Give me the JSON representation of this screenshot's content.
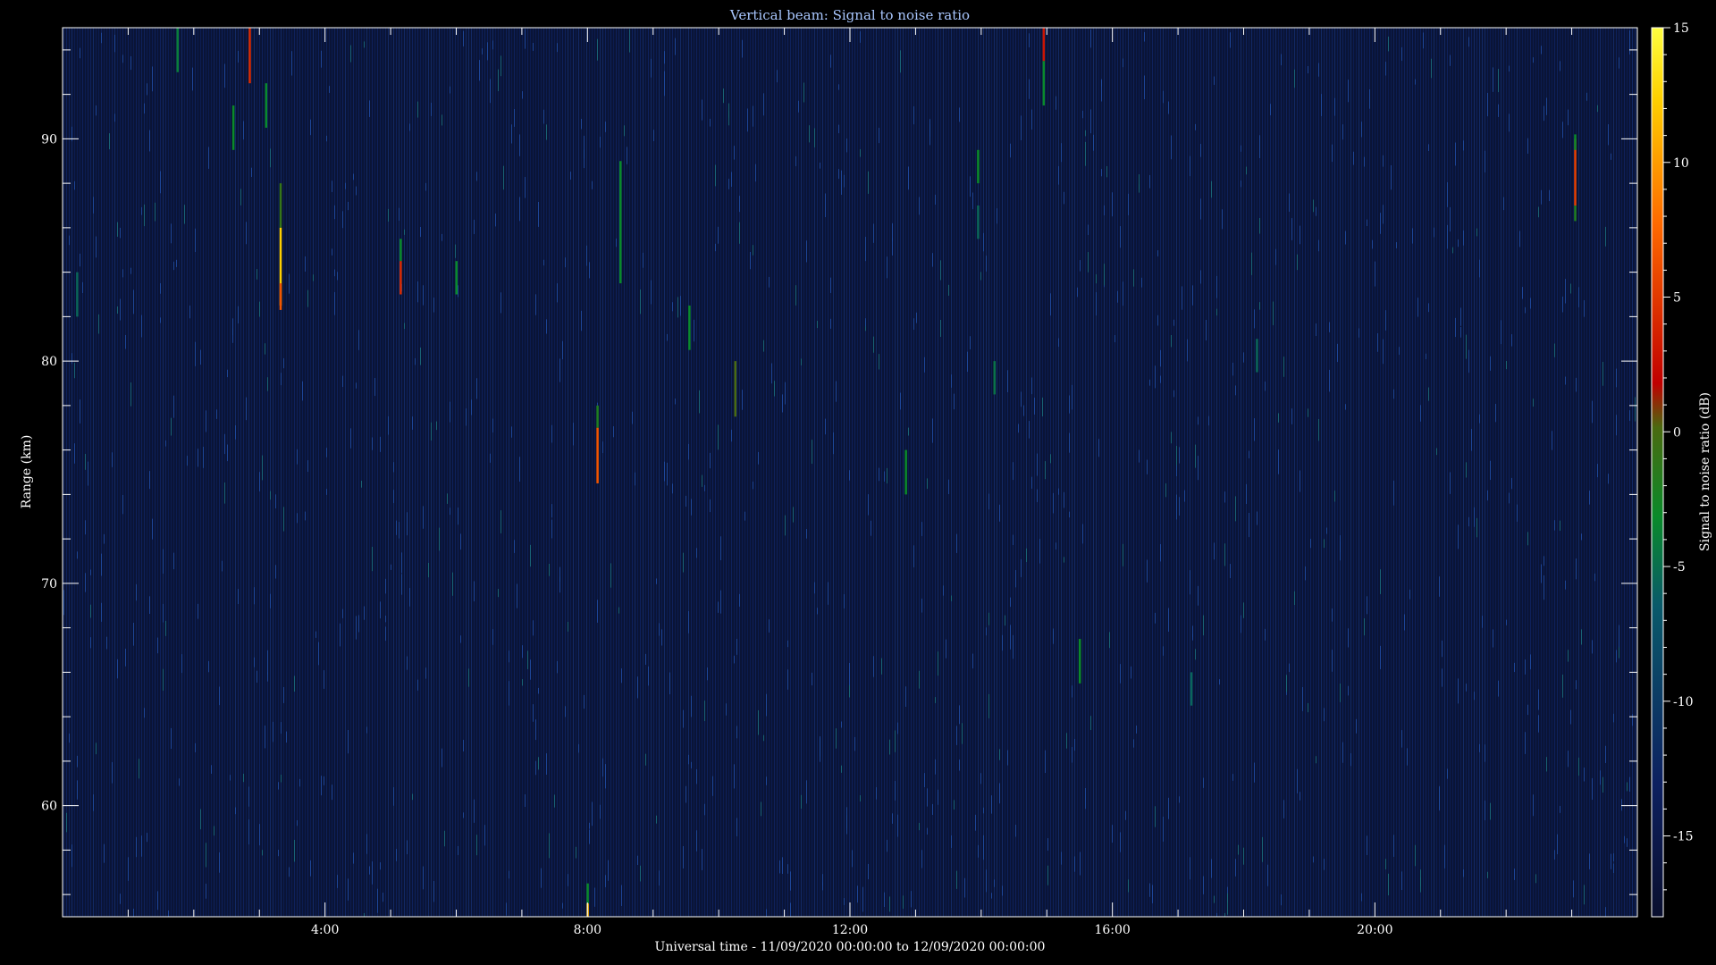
{
  "chart_data": {
    "type": "heatmap",
    "title": "Vertical beam: Signal to noise ratio",
    "xlabel": "Universal time - 11/09/2020 00:00:00 to 12/09/2020 00:00:00",
    "ylabel": "Range (km)",
    "colorbar_label": "Signal to noise ratio (dB)",
    "xlim_hours": [
      0,
      24
    ],
    "ylim_km": [
      55,
      95
    ],
    "clim_db": [
      -18,
      15
    ],
    "x_ticks": [
      {
        "hour": 4,
        "label": "4:00"
      },
      {
        "hour": 8,
        "label": "8:00"
      },
      {
        "hour": 12,
        "label": "12:00"
      },
      {
        "hour": 16,
        "label": "16:00"
      },
      {
        "hour": 20,
        "label": "20:00"
      }
    ],
    "y_ticks": [
      {
        "km": 60,
        "label": "60"
      },
      {
        "km": 70,
        "label": "70"
      },
      {
        "km": 80,
        "label": "80"
      },
      {
        "km": 90,
        "label": "90"
      }
    ],
    "colorbar_ticks": [
      {
        "db": 15,
        "label": "15"
      },
      {
        "db": 10,
        "label": "10"
      },
      {
        "db": 5,
        "label": "5"
      },
      {
        "db": 0,
        "label": "0"
      },
      {
        "db": -5,
        "label": "-5"
      },
      {
        "db": -10,
        "label": "-10"
      },
      {
        "db": -15,
        "label": "-15"
      }
    ],
    "background_db": -15,
    "echoes": [
      {
        "hour": 0.22,
        "range_start": 82.0,
        "range_end": 84.0,
        "db": -9
      },
      {
        "hour": 1.75,
        "range_start": 93.0,
        "range_end": 95.0,
        "db": -7
      },
      {
        "hour": 2.6,
        "range_start": 89.5,
        "range_end": 91.5,
        "db": -6
      },
      {
        "hour": 2.85,
        "range_start": 92.5,
        "range_end": 95.0,
        "db": 2
      },
      {
        "hour": 3.1,
        "range_start": 90.5,
        "range_end": 92.5,
        "db": -6
      },
      {
        "hour": 3.32,
        "range_start": 86.0,
        "range_end": 88.0,
        "db": -4
      },
      {
        "hour": 3.32,
        "range_start": 82.5,
        "range_end": 86.0,
        "db": 10
      },
      {
        "hour": 3.32,
        "range_start": 82.3,
        "range_end": 83.5,
        "db": 4
      },
      {
        "hour": 5.15,
        "range_start": 84.5,
        "range_end": 85.5,
        "db": -6
      },
      {
        "hour": 5.15,
        "range_start": 83.0,
        "range_end": 84.5,
        "db": 2
      },
      {
        "hour": 6.0,
        "range_start": 83.0,
        "range_end": 84.5,
        "db": -6
      },
      {
        "hour": 8.0,
        "range_start": 55.0,
        "range_end": 56.5,
        "db": -6
      },
      {
        "hour": 8.0,
        "range_start": 55.0,
        "range_end": 55.6,
        "db": 8
      },
      {
        "hour": 8.15,
        "range_start": 77.0,
        "range_end": 78.0,
        "db": -5
      },
      {
        "hour": 8.15,
        "range_start": 74.5,
        "range_end": 77.0,
        "db": 4
      },
      {
        "hour": 8.5,
        "range_start": 83.5,
        "range_end": 89.0,
        "db": -6
      },
      {
        "hour": 9.55,
        "range_start": 80.5,
        "range_end": 82.5,
        "db": -6
      },
      {
        "hour": 10.25,
        "range_start": 77.5,
        "range_end": 80.0,
        "db": -3
      },
      {
        "hour": 12.85,
        "range_start": 74.0,
        "range_end": 76.0,
        "db": -6
      },
      {
        "hour": 13.95,
        "range_start": 88.0,
        "range_end": 89.5,
        "db": -6
      },
      {
        "hour": 13.95,
        "range_start": 85.5,
        "range_end": 87.0,
        "db": -9
      },
      {
        "hour": 14.2,
        "range_start": 78.5,
        "range_end": 80.0,
        "db": -8
      },
      {
        "hour": 14.95,
        "range_start": 93.5,
        "range_end": 95.0,
        "db": 1
      },
      {
        "hour": 14.95,
        "range_start": 91.5,
        "range_end": 93.5,
        "db": -6
      },
      {
        "hour": 15.5,
        "range_start": 65.5,
        "range_end": 67.5,
        "db": -6
      },
      {
        "hour": 17.2,
        "range_start": 64.5,
        "range_end": 66.0,
        "db": -9
      },
      {
        "hour": 18.2,
        "range_start": 79.5,
        "range_end": 81.0,
        "db": -9
      },
      {
        "hour": 23.05,
        "range_start": 87.0,
        "range_end": 90.0,
        "db": 3
      },
      {
        "hour": 23.05,
        "range_start": 86.3,
        "range_end": 87.0,
        "db": -5
      },
      {
        "hour": 23.05,
        "range_start": 89.5,
        "range_end": 90.2,
        "db": -6
      }
    ]
  }
}
